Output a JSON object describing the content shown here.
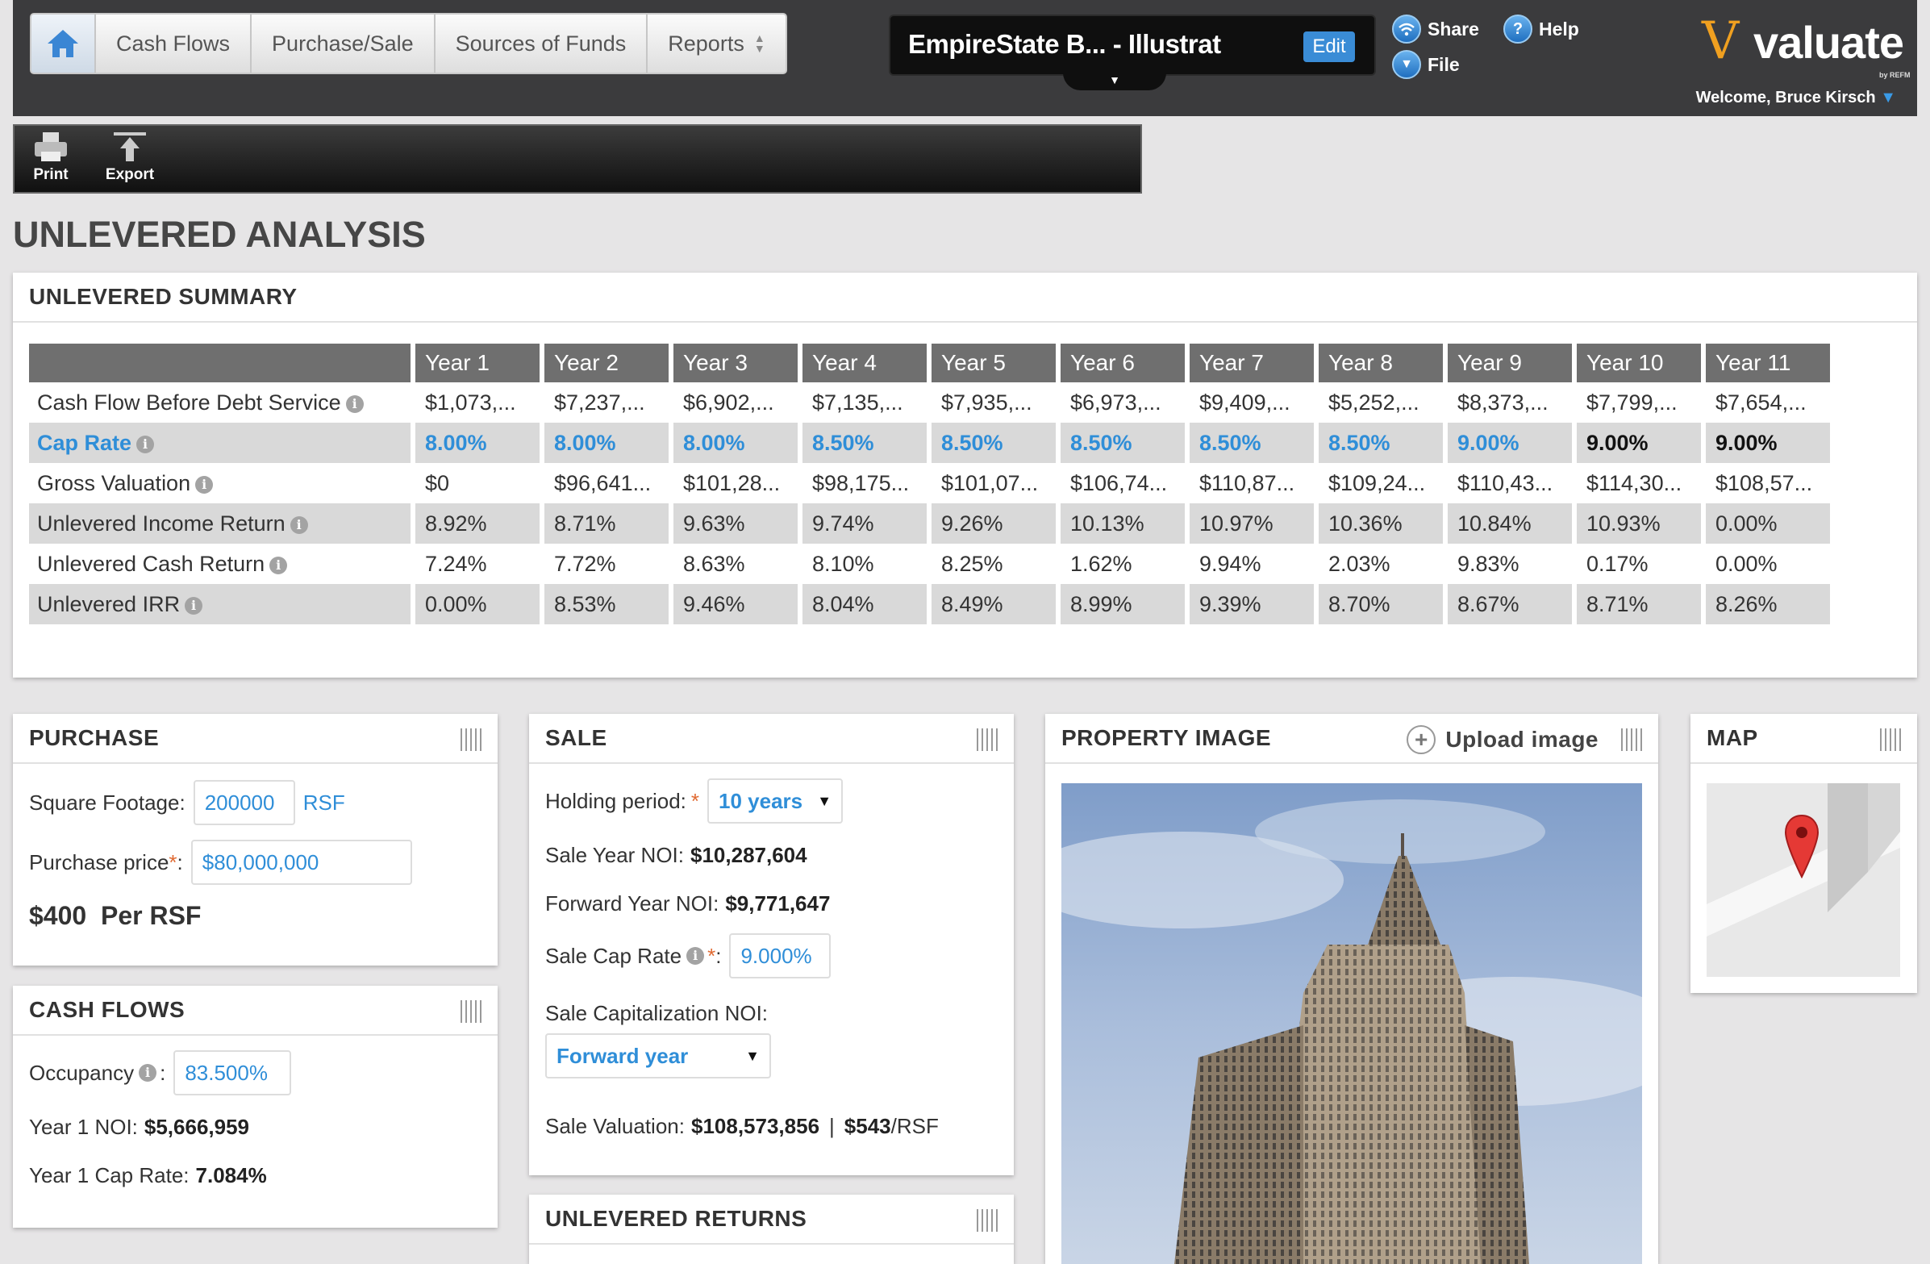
{
  "nav": {
    "home_icon": "home-icon",
    "items": [
      "Cash Flows",
      "Purchase/Sale",
      "Sources of Funds",
      "Reports"
    ]
  },
  "project": {
    "title": "EmpireState B... - Illustrat",
    "edit_label": "Edit"
  },
  "links": {
    "share": "Share",
    "help": "Help",
    "file": "File"
  },
  "brand": {
    "logo_text": "valuate",
    "logo_sub": "by REFM",
    "welcome": "Welcome, Bruce Kirsch",
    "accent_color": "#3a8cd6",
    "logo_color": "#f0a020"
  },
  "toolbar": {
    "print": "Print",
    "export": "Export"
  },
  "page_title": "UNLEVERED ANALYSIS",
  "summary": {
    "title": "UNLEVERED SUMMARY",
    "columns": [
      "Year 1",
      "Year 2",
      "Year 3",
      "Year 4",
      "Year 5",
      "Year 6",
      "Year 7",
      "Year 8",
      "Year 9",
      "Year 10",
      "Year 11"
    ],
    "rows": [
      {
        "label": "Cash Flow Before Debt Service",
        "values": [
          "$1,073,...",
          "$7,237,...",
          "$6,902,...",
          "$7,135,...",
          "$7,935,...",
          "$6,973,...",
          "$9,409,...",
          "$5,252,...",
          "$8,373,...",
          "$7,799,...",
          "$7,654,..."
        ]
      },
      {
        "label": "Cap Rate",
        "values": [
          "8.00%",
          "8.00%",
          "8.00%",
          "8.50%",
          "8.50%",
          "8.50%",
          "8.50%",
          "8.50%",
          "9.00%",
          "9.00%",
          "9.00%"
        ]
      },
      {
        "label": "Gross Valuation",
        "values": [
          "$0",
          "$96,641...",
          "$101,28...",
          "$98,175...",
          "$101,07...",
          "$106,74...",
          "$110,87...",
          "$109,24...",
          "$110,43...",
          "$114,30...",
          "$108,57..."
        ]
      },
      {
        "label": "Unlevered Income Return",
        "values": [
          "8.92%",
          "8.71%",
          "9.63%",
          "9.74%",
          "9.26%",
          "10.13%",
          "10.97%",
          "10.36%",
          "10.84%",
          "10.93%",
          "0.00%"
        ]
      },
      {
        "label": "Unlevered Cash Return",
        "values": [
          "7.24%",
          "7.72%",
          "8.63%",
          "8.10%",
          "8.25%",
          "1.62%",
          "9.94%",
          "2.03%",
          "9.83%",
          "0.17%",
          "0.00%"
        ]
      },
      {
        "label": "Unlevered IRR",
        "values": [
          "0.00%",
          "8.53%",
          "9.46%",
          "8.04%",
          "8.49%",
          "8.99%",
          "9.39%",
          "8.70%",
          "8.67%",
          "8.71%",
          "8.26%"
        ]
      }
    ]
  },
  "purchase": {
    "title": "PURCHASE",
    "sqft_label": "Square Footage:",
    "sqft_value": "200000",
    "sqft_unit": "RSF",
    "price_label": "Purchase price",
    "price_value": "$80,000,000",
    "per_rsf": "$400  Per RSF"
  },
  "cashflows": {
    "title": "CASH FLOWS",
    "occupancy_label": "Occupancy",
    "occupancy_value": "83.500%",
    "noi_label": "Year 1 NOI:",
    "noi_value": "$5,666,959",
    "cap_label": "Year 1 Cap Rate:",
    "cap_value": "7.084%"
  },
  "sale": {
    "title": "SALE",
    "holding_label": "Holding period:",
    "holding_value": "10 years",
    "sale_noi_label": "Sale Year NOI:",
    "sale_noi_value": "$10,287,604",
    "fwd_noi_label": "Forward Year NOI:",
    "fwd_noi_value": "$9,771,647",
    "cap_label": "Sale Cap Rate",
    "cap_value": "9.000%",
    "cap_noi_label": "Sale Capitalization NOI:",
    "cap_noi_value": "Forward year",
    "valuation_label": "Sale Valuation:",
    "valuation_value": "$108,573,856",
    "valuation_sep": "|",
    "valuation_rsf": "$543",
    "valuation_rsf_unit": "/RSF"
  },
  "returns": {
    "title": "UNLEVERED RETURNS"
  },
  "property": {
    "title": "PROPERTY IMAGE",
    "upload_label": "Upload image"
  },
  "map": {
    "title": "MAP"
  }
}
